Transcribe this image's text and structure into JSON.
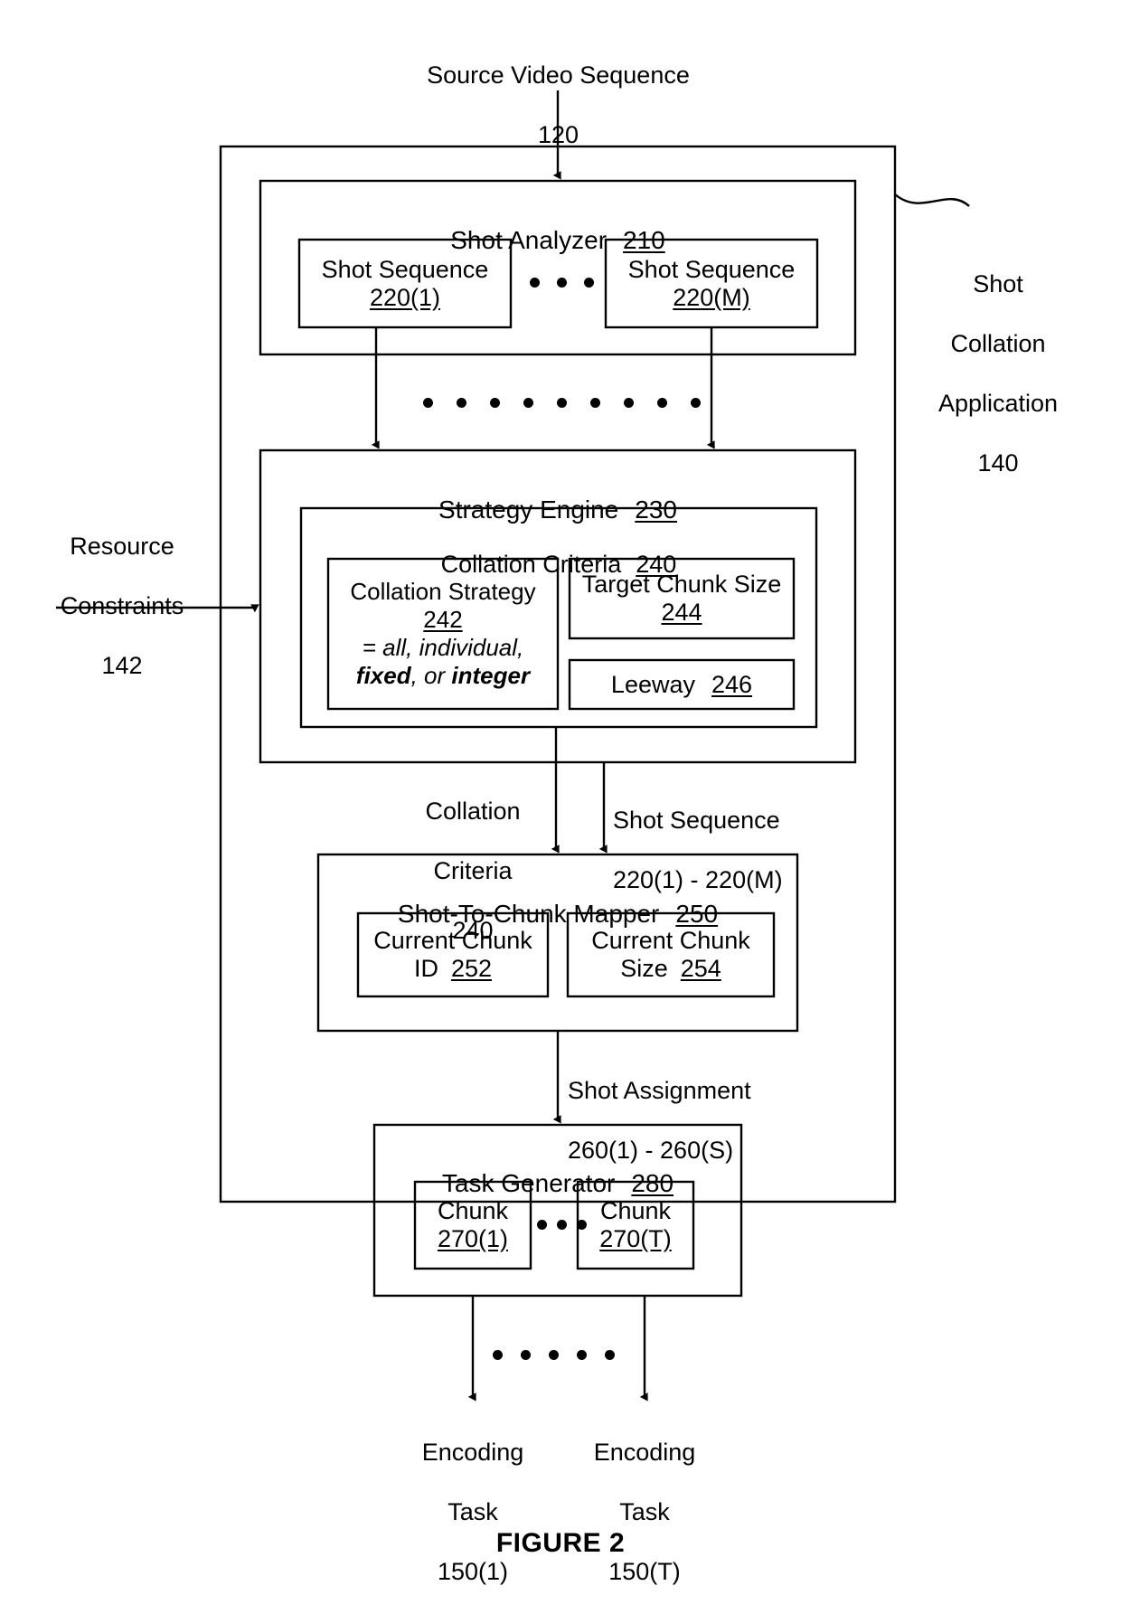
{
  "figure": {
    "caption": "FIGURE 2"
  },
  "top_input": {
    "label": "Source Video Sequence",
    "ref": "120"
  },
  "outer_container": {
    "label_line1": "Shot",
    "label_line2": "Collation",
    "label_line3": "Application",
    "ref": "140"
  },
  "left_input": {
    "label_line1": "Resource",
    "label_line2": "Constraints",
    "ref": "142"
  },
  "shot_analyzer": {
    "title": "Shot Analyzer",
    "ref": "210",
    "items": [
      {
        "label": "Shot Sequence",
        "ref": "220(1)"
      },
      {
        "label": "Shot Sequence",
        "ref": "220(M)"
      }
    ]
  },
  "strategy_engine": {
    "title": "Strategy Engine",
    "ref": "230",
    "collation_criteria": {
      "title": "Collation Criteria",
      "ref": "240",
      "collation_strategy": {
        "label": "Collation Strategy",
        "ref": "242",
        "value_line1": "= all, individual,",
        "value_line2_bold_a": "fixed",
        "value_line2_mid": ", or ",
        "value_line2_bold_b": "integer"
      },
      "target_chunk_size": {
        "label": "Target Chunk Size",
        "ref": "244"
      },
      "leeway": {
        "label": "Leeway",
        "ref": "246"
      }
    }
  },
  "edge_collation_criteria": {
    "line1": "Collation",
    "line2": "Criteria",
    "line3": "240"
  },
  "edge_shot_sequence": {
    "line1": "Shot Sequence",
    "line2": "220(1) - 220(M)"
  },
  "shot_to_chunk_mapper": {
    "title": "Shot-To-Chunk Mapper",
    "ref": "250",
    "current_chunk_id": {
      "line1": "Current Chunk",
      "line2_label": "ID",
      "ref": "252"
    },
    "current_chunk_size": {
      "line1": "Current Chunk",
      "line2_label": "Size",
      "ref": "254"
    }
  },
  "edge_shot_assignment": {
    "line1": "Shot Assignment",
    "line2": "260(1) - 260(S)"
  },
  "task_generator": {
    "title": "Task Generator",
    "ref": "280",
    "chunks": [
      {
        "label": "Chunk",
        "ref": "270(1)"
      },
      {
        "label": "Chunk",
        "ref": "270(T)"
      }
    ]
  },
  "encoding_tasks": [
    {
      "line1": "Encoding",
      "line2": "Task",
      "ref": "150(1)"
    },
    {
      "line1": "Encoding",
      "line2": "Task",
      "ref": "150(T)"
    }
  ],
  "colors": {
    "stroke": "#000000",
    "background": "#ffffff"
  }
}
